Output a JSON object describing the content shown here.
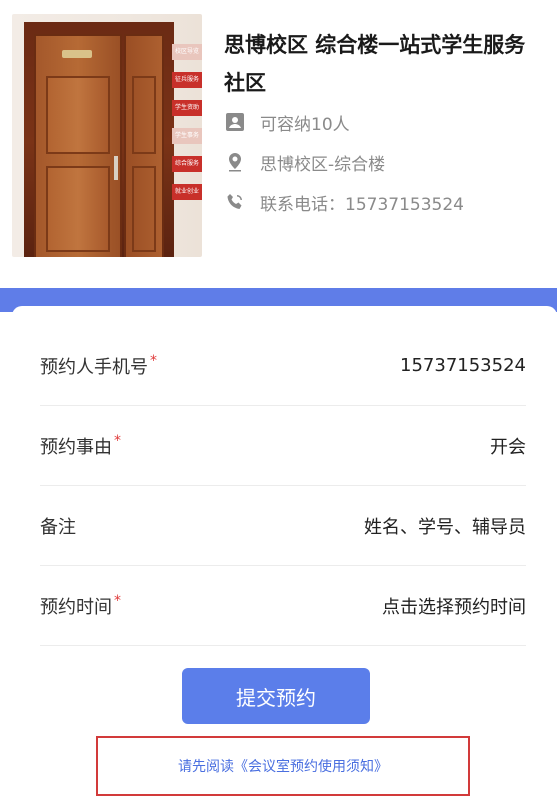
{
  "venue": {
    "name": "思博校区 综合楼一站式学生服务社区",
    "capacity": "可容纳10人",
    "location": "思博校区-综合楼",
    "phone": "联系电话：15737153524",
    "icons": [
      "person-card-icon",
      "location-pin-icon",
      "phone-icon"
    ],
    "photo_signs": [
      "校区导览",
      "征兵服务",
      "学生资助",
      "学生事务",
      "综合服务",
      "就业创业"
    ]
  },
  "form": {
    "rows": [
      {
        "label": "预约人手机号",
        "required": "*",
        "value": "15737153524"
      },
      {
        "label": "预约事由",
        "required": "*",
        "value": "开会"
      },
      {
        "label": "备注",
        "required": "",
        "value": "姓名、学号、辅导员"
      },
      {
        "label": "预约时间",
        "required": "*",
        "value": "点击选择预约时间"
      }
    ],
    "submit_label": "提交预约",
    "notice_link": "请先阅读《会议室预约使用须知》"
  },
  "colors": {
    "accent": "#5b7eea",
    "band": "#5f7de8",
    "required": "#e03a3a",
    "notice_border": "#d23a3a"
  }
}
